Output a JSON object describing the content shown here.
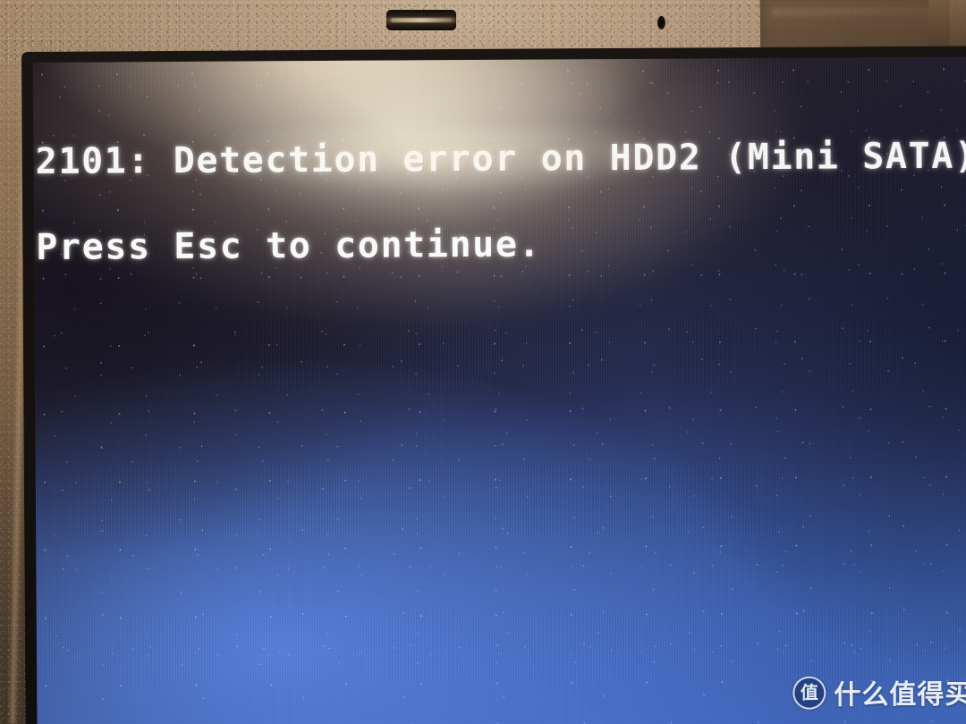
{
  "device": {
    "type": "laptop-screen-photo",
    "bezel_color": "#8e7154",
    "screen_bottom_color": "#3a63b4",
    "screen_top_color": "#241d22"
  },
  "bezel": {
    "camera_slot_label": "webcam-slot",
    "mic_hole_label": "microphone-hole",
    "tape_patch_label": "tape-patch"
  },
  "screen": {
    "error_code": "2101",
    "line_1": "2101: Detection error on HDD2 (Mini SATA)",
    "line_2": "Press Esc to continue.",
    "text_color": "#ffffff",
    "key_hint": "Esc",
    "device_name": "HDD2 (Mini SATA)",
    "message": "Detection error"
  },
  "watermark": {
    "logo_glyph": "值",
    "text": "什么值得买"
  }
}
